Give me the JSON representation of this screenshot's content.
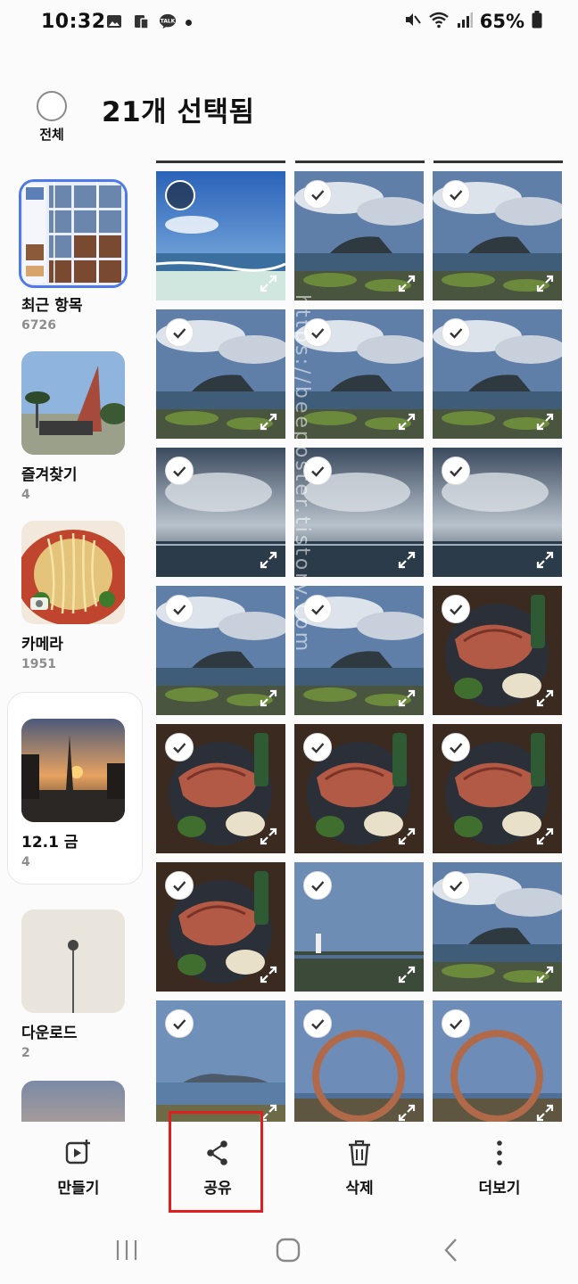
{
  "status": {
    "time": "10:32",
    "battery": "65%"
  },
  "header": {
    "select_all_label": "전체",
    "title": "21개 선택됨"
  },
  "albums": [
    {
      "name": "최근 항목",
      "count": "6726"
    },
    {
      "name": "즐겨찾기",
      "count": "4"
    },
    {
      "name": "카메라",
      "count": "1951"
    },
    {
      "name": "12.1 금",
      "count": "4"
    },
    {
      "name": "다운로드",
      "count": "2"
    }
  ],
  "photos": {
    "total_tiles": 21,
    "first_tile_selected": false,
    "content": [
      "beach",
      "coast",
      "coast",
      "coast",
      "coast",
      "coast",
      "sea-clouds",
      "sea-clouds",
      "sea-clouds",
      "coast",
      "coast",
      "food",
      "food",
      "food",
      "food",
      "food",
      "coast-lighthouse",
      "coast",
      "sea",
      "ring-sculpture",
      "ring-sculpture"
    ]
  },
  "watermark": "https://beeposter.tistory.com",
  "actions": {
    "create": "만들기",
    "share": "공유",
    "delete": "삭제",
    "more": "더보기"
  },
  "colors": {
    "accent": "#4f79e6",
    "highlight": "#e02020"
  }
}
